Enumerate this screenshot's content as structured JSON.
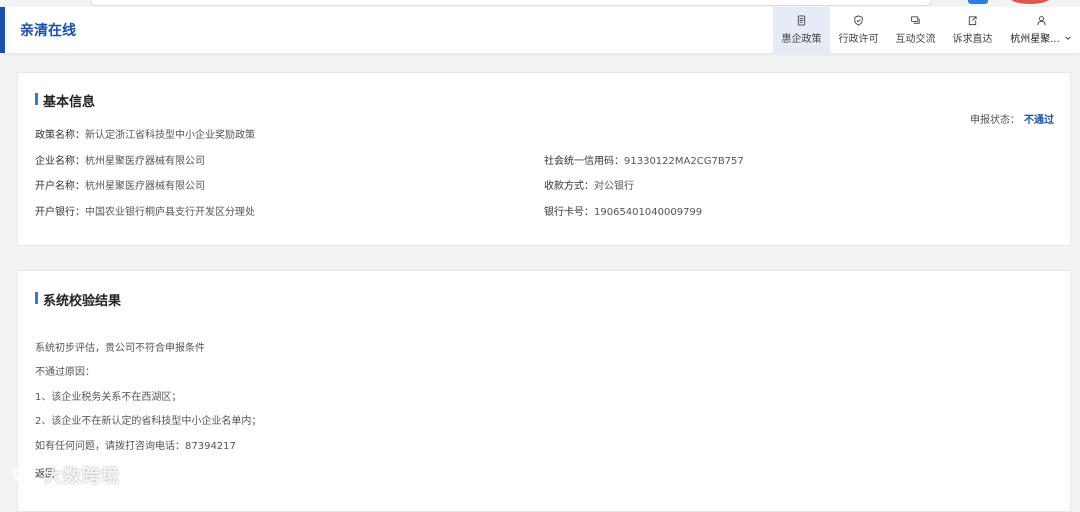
{
  "header": {
    "title": "亲清在线",
    "nav": [
      {
        "label": "惠企政策",
        "icon": "document-icon",
        "active": true
      },
      {
        "label": "行政许可",
        "icon": "shield-check-icon",
        "active": false
      },
      {
        "label": "互动交流",
        "icon": "chat-icon",
        "active": false
      },
      {
        "label": "诉求直达",
        "icon": "export-icon",
        "active": false
      }
    ],
    "user": {
      "label": "杭州星聚...",
      "icon": "user-icon"
    }
  },
  "basic_info": {
    "title": "基本信息",
    "status_label": "申报状态：",
    "status_value": "不通过",
    "policy_name_label": "政策名称：",
    "policy_name_value": "新认定浙江省科技型中小企业奖励政策",
    "company_label": "企业名称：",
    "company_value": "杭州星聚医疗器械有限公司",
    "credit_code_label": "社会统一信用码：",
    "credit_code_value": "91330122MA2CG7B757",
    "account_name_label": "开户名称：",
    "account_name_value": "杭州星聚医疗器械有限公司",
    "payment_method_label": "收款方式：",
    "payment_method_value": "对公银行",
    "bank_label": "开户银行：",
    "bank_value": "中国农业银行桐庐县支行开发区分理处",
    "card_no_label": "银行卡号：",
    "card_no_value": "19065401040009799"
  },
  "verification": {
    "title": "系统校验结果",
    "lines": [
      "系统初步评估，贵公司不符合申报条件",
      "不通过原因：",
      "1、该企业税务关系不在西湖区；",
      "2、该企业不在新认定的省科技型中小企业名单内；",
      "如有任何问题，请拨打咨询电话：87394217"
    ],
    "back_label": "返回"
  },
  "watermark": {
    "text": "大数跨境"
  }
}
